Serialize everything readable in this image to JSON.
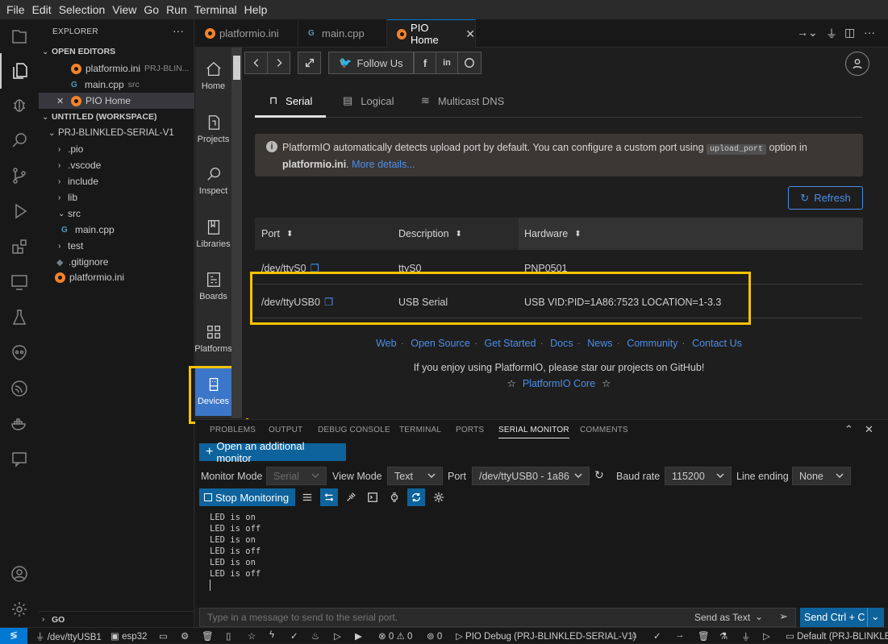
{
  "menu": [
    "File",
    "Edit",
    "Selection",
    "View",
    "Go",
    "Run",
    "Terminal",
    "Help"
  ],
  "explorer": {
    "title": "EXPLORER",
    "more": "···",
    "open_editors_label": "OPEN EDITORS",
    "open_editors": [
      {
        "name": "platformio.ini",
        "path": "PRJ-BLIN..."
      },
      {
        "name": "main.cpp",
        "path": "src"
      },
      {
        "name": "PIO Home",
        "close": "✕"
      }
    ],
    "workspace_label": "UNTITLED (WORKSPACE)",
    "project": "PRJ-BLINKLED-SERIAL-V1",
    "tree": [
      ".pio",
      ".vscode",
      "include",
      "lib",
      "src",
      "main.cpp",
      "test",
      ".gitignore",
      "platformio.ini"
    ],
    "go_label": "GO"
  },
  "tabs": [
    {
      "label": "platformio.ini"
    },
    {
      "label": "main.cpp"
    },
    {
      "label": "PIO Home",
      "close": "✕"
    }
  ],
  "pio_nav": [
    "Home",
    "Projects",
    "Inspect",
    "Libraries",
    "Boards",
    "Platforms",
    "Devices"
  ],
  "pio_home": {
    "follow": "Follow Us",
    "subtabs": [
      "Serial",
      "Logical",
      "Multicast DNS"
    ],
    "info_text": "PlatformIO automatically detects upload port by default. You can configure a custom port using",
    "info_code": "upload_port",
    "info_text2": "option in",
    "info_file": "platformio.ini",
    "info_link": "More details...",
    "refresh": "Refresh",
    "columns": [
      "Port",
      "Description",
      "Hardware"
    ],
    "rows": [
      {
        "port": "/dev/ttyS0",
        "description": "ttyS0",
        "hardware": "PNP0501"
      },
      {
        "port": "/dev/ttyUSB0",
        "description": "USB Serial",
        "hardware": "USB VID:PID=1A86:7523 LOCATION=1-3.3"
      }
    ],
    "links": [
      "Web",
      "Open Source",
      "Get Started",
      "Docs",
      "News",
      "Community",
      "Contact Us"
    ],
    "star_msg": "If you enjoy using PlatformIO, please star our projects on GitHub!",
    "core_link": "PlatformIO Core",
    "highlight_color": "#f5c400"
  },
  "panel": {
    "tabs": [
      "PROBLEMS",
      "OUTPUT",
      "DEBUG CONSOLE",
      "TERMINAL",
      "PORTS",
      "SERIAL MONITOR",
      "COMMENTS"
    ],
    "open_monitor": "Open an additional monitor",
    "monitor_mode_label": "Monitor Mode",
    "monitor_mode": "Serial",
    "view_mode_label": "View Mode",
    "view_mode": "Text",
    "port_label": "Port",
    "port": "/dev/ttyUSB0 - 1a86",
    "baud_label": "Baud rate",
    "baud": "115200",
    "line_ending_label": "Line ending",
    "line_ending": "None",
    "stop": "Stop Monitoring",
    "output": [
      "LED is on",
      "LED is off",
      "LED is on",
      "LED is off",
      "LED is on",
      "LED is off"
    ],
    "msg_placeholder": "Type in a message to send to the serial port.",
    "send_as": "Send as Text",
    "send_btn": "Send Ctrl + C"
  },
  "status": {
    "port": "/dev/ttyUSB1",
    "board": "esp32",
    "problems_errors": "0",
    "problems_warnings": "0",
    "ports": "0",
    "debug": "PIO Debug (PRJ-BLINKLED-SERIAL-V1)",
    "env": "Default (PRJ-BLINKLED-SERI"
  }
}
